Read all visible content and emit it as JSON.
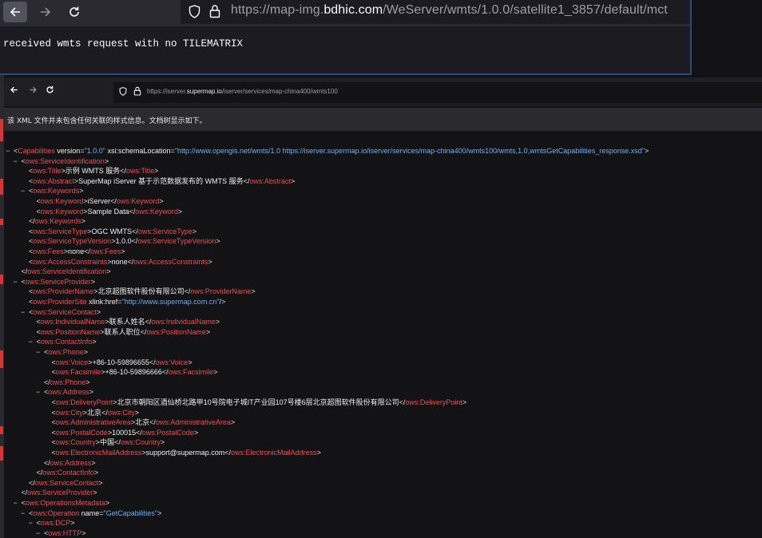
{
  "top_window": {
    "url_prefix": "https://map-img.",
    "url_domain": "bdhic.com",
    "url_path": "/WeServer/wmts/1.0.0/satellite1_3857/default/mct",
    "body_text": "received wmts request with no TILEMATRIX"
  },
  "bottom_window": {
    "url_prefix": "https://iserver.",
    "url_domain": "supermap.io",
    "url_path": "/iserver/services/map-china400/wmts100",
    "notice": "该 XML 文件并未包含任何关联的样式信息。文档树显示如下。"
  },
  "xml_lines": [
    {
      "indent": 0,
      "toggle": "−",
      "open": "Capabilities",
      "attrs": [
        {
          "name": "version",
          "value": "\"1.0.0\""
        },
        {
          "name": "xsi:schemaLocation",
          "value": "\"http://www.opengis.net/wmts/1.0 https://iserver.supermap.io/iserver/services/map-china400/wmts100/wmts,1.0,wmtsGetCapabilities_response.xsd\""
        }
      ]
    },
    {
      "indent": 1,
      "toggle": "−",
      "open": "ows:ServiceIdentification"
    },
    {
      "indent": 2,
      "open": "ows:Title",
      "text": "示例 WMTS 服务",
      "close": "ows:Title"
    },
    {
      "indent": 2,
      "open": "ows:Abstract",
      "text": "SuperMap iServer 基于示范数据发布的 WMTS 服务",
      "close": "ows:Abstract"
    },
    {
      "indent": 2,
      "toggle": "−",
      "open": "ows:Keywords"
    },
    {
      "indent": 3,
      "open": "ows:Keyword",
      "text": "iServer",
      "close": "ows:Keyword"
    },
    {
      "indent": 3,
      "open": "ows:Keyword",
      "text": "Sample Data",
      "close": "ows:Keyword"
    },
    {
      "indent": 2,
      "close": "ows:Keywords"
    },
    {
      "indent": 2,
      "open": "ows:ServiceType",
      "text": "OGC WMTS",
      "close": "ows:ServiceType"
    },
    {
      "indent": 2,
      "open": "ows:ServiceTypeVersion",
      "text": "1.0.0",
      "close": "ows:ServiceTypeVersion"
    },
    {
      "indent": 2,
      "open": "ows:Fees",
      "text": "none",
      "close": "ows:Fees"
    },
    {
      "indent": 2,
      "open": "ows:AccessConstraints",
      "text": "none",
      "close": "ows:AccessConstraints"
    },
    {
      "indent": 1,
      "close": "ows:ServiceIdentification"
    },
    {
      "indent": 1,
      "toggle": "−",
      "open": "ows:ServiceProvider"
    },
    {
      "indent": 2,
      "open": "ows:ProviderName",
      "text": "北京超图软件股份有限公司",
      "close": "ows:ProviderName"
    },
    {
      "indent": 2,
      "open": "ows:ProviderSite",
      "attrs": [
        {
          "name": "xlink:href",
          "value": "\"http://www.supermap.com.cn\""
        }
      ],
      "selfclose": true
    },
    {
      "indent": 2,
      "toggle": "−",
      "open": "ows:ServiceContact"
    },
    {
      "indent": 3,
      "open": "ows:IndividualName",
      "text": "联系人姓名",
      "close": "ows:IndividualName"
    },
    {
      "indent": 3,
      "open": "ows:PositionName",
      "text": "联系人职位",
      "close": "ows:PositionName"
    },
    {
      "indent": 3,
      "toggle": "−",
      "open": "ows:ContactInfo"
    },
    {
      "indent": 4,
      "toggle": "−",
      "open": "ows:Phone"
    },
    {
      "indent": 5,
      "open": "ows:Voice",
      "text": "+86-10-59896655",
      "close": "ows:Voice"
    },
    {
      "indent": 5,
      "open": "ows:Facsimile",
      "text": "+86-10-59896666",
      "close": "ows:Facsimile"
    },
    {
      "indent": 4,
      "close": "ows:Phone"
    },
    {
      "indent": 4,
      "toggle": "−",
      "open": "ows:Address"
    },
    {
      "indent": 5,
      "open": "ows:DeliveryPoint",
      "text": "北京市朝阳区酒仙桥北路甲10号院电子城IT产业园107号楼6层北京超图软件股份有限公司",
      "close": "ows:DeliveryPoint"
    },
    {
      "indent": 5,
      "open": "ows:City",
      "text": "北京",
      "close": "ows:City"
    },
    {
      "indent": 5,
      "open": "ows:AdministrativeArea",
      "text": "北京",
      "close": "ows:AdministrativeArea"
    },
    {
      "indent": 5,
      "open": "ows:PostalCode",
      "text": "100015",
      "close": "ows:PostalCode"
    },
    {
      "indent": 5,
      "open": "ows:Country",
      "text": "中国",
      "close": "ows:Country"
    },
    {
      "indent": 5,
      "open": "ows:ElectronicMailAddress",
      "text": "support@supermap.com",
      "close": "ows:ElectronicMailAddress"
    },
    {
      "indent": 4,
      "close": "ows:Address"
    },
    {
      "indent": 3,
      "close": "ows:ContactInfo"
    },
    {
      "indent": 2,
      "close": "ows:ServiceContact"
    },
    {
      "indent": 1,
      "close": "ows:ServiceProvider"
    },
    {
      "indent": 1,
      "toggle": "−",
      "open": "ows:OperationsMetadata"
    },
    {
      "indent": 2,
      "toggle": "−",
      "open": "ows:Operation",
      "attrs": [
        {
          "name": "name",
          "value": "\"GetCapabilities\""
        }
      ]
    },
    {
      "indent": 3,
      "toggle": "−",
      "open": "ows:DCP"
    },
    {
      "indent": 4,
      "toggle": "−",
      "open": "ows:HTTP"
    }
  ]
}
